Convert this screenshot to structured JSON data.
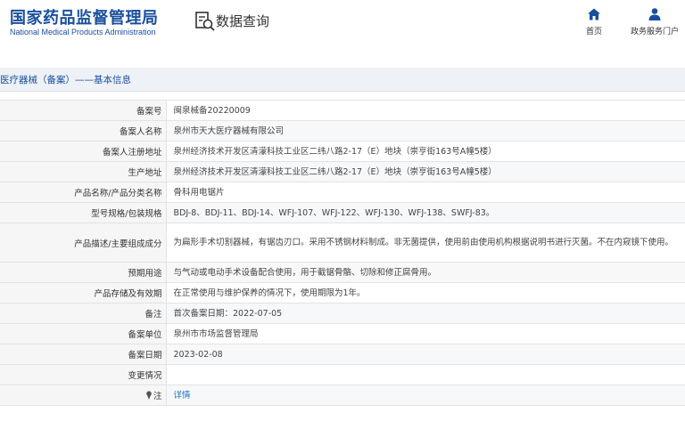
{
  "header": {
    "logo_cn": "国家药品监督管理局",
    "logo_en": "National Medical Products Administration",
    "page_title": "数据查询",
    "nav": {
      "home": "首页",
      "portal": "政务服务门户"
    }
  },
  "breadcrumb": "医疗器械（备案）——基本信息",
  "colors": {
    "brand": "#1a4f9c",
    "link": "#1a6fc7",
    "label_bg": "#f6f6f6"
  },
  "rows": [
    {
      "label": "备案号",
      "value": "闽泉械备20220009"
    },
    {
      "label": "备案人名称",
      "value": "泉州市天大医疗器械有限公司"
    },
    {
      "label": "备案人注册地址",
      "value": "泉州经济技术开发区清濛科技工业区二纬八路2-17（E）地块（崇亨街163号A幢5楼）"
    },
    {
      "label": "生产地址",
      "value": "泉州经济技术开发区清濛科技工业区二纬八路2-17（E）地块（崇亨街163号A幢5楼）"
    },
    {
      "label": "产品名称/产品分类名称",
      "value": "骨科用电锯片"
    },
    {
      "label": "型号规格/包装规格",
      "value": "BDJ-8、BDJ-11、BDJ-14、WFJ-107、WFJ-122、WFJ-130、WFJ-138、SWFJ-83。"
    },
    {
      "label": "产品描述/主要组成成分",
      "value": "为扁形手术切割器械，有锯齿刃口。采用不锈钢材料制成。非无菌提供，使用前由使用机构根据说明书进行灭菌。不在内窥镜下使用。"
    },
    {
      "label": "预期用途",
      "value": "与气动或电动手术设备配合使用，用于截锯骨骼、切除和修正腐骨用。"
    },
    {
      "label": "产品存储及有效期",
      "value": "在正常使用与维护保养的情况下，使用期限为1年。"
    },
    {
      "label": "备注",
      "value": "首次备案日期：2022-07-05"
    },
    {
      "label": "备案单位",
      "value": "泉州市市场监督管理局"
    },
    {
      "label": "备案日期",
      "value": "2023-02-08"
    },
    {
      "label": "变更情况",
      "value": ""
    },
    {
      "label": "注",
      "value": "详情"
    }
  ]
}
